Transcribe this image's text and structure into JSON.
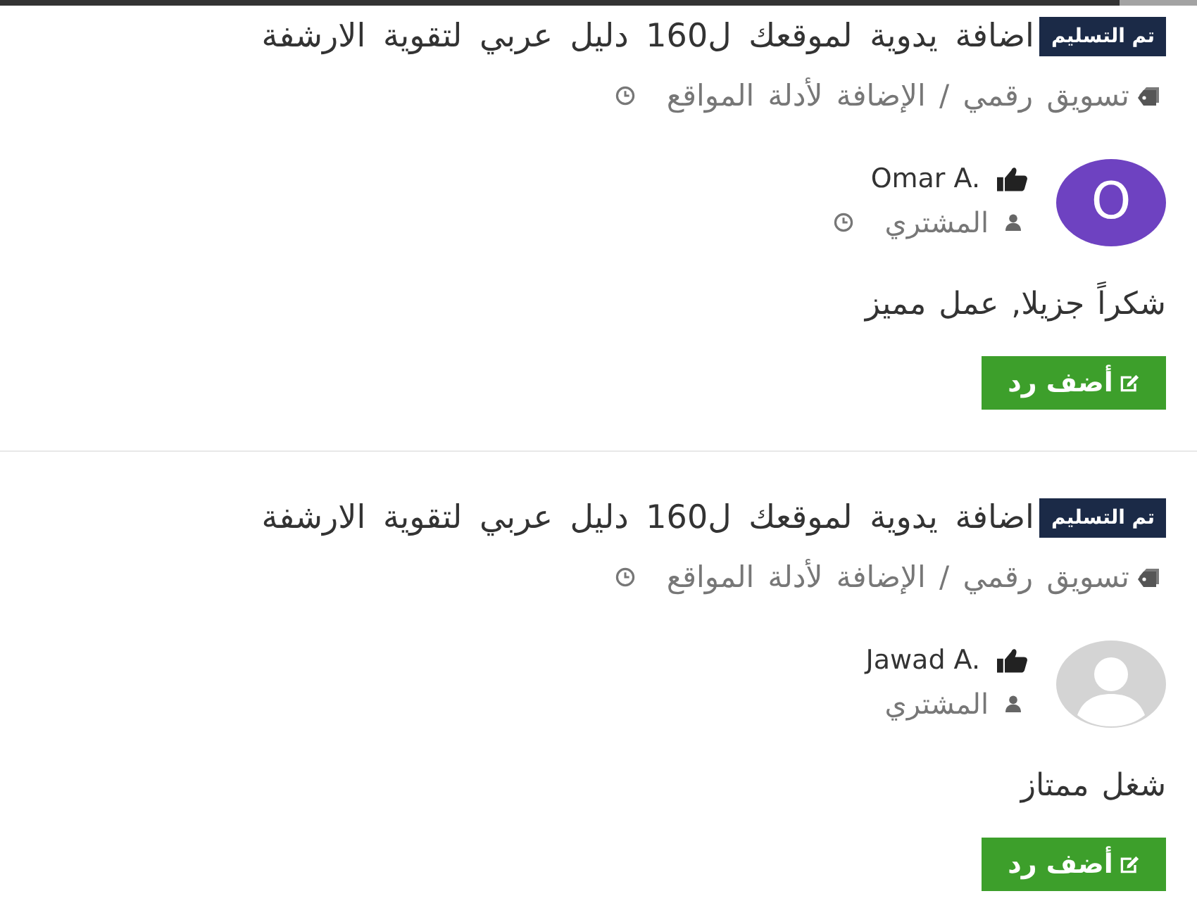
{
  "reviews": [
    {
      "status_badge": "تم التسليم",
      "title": "اضافة يدوية لموقعك ل160 دليل عربي لتقوية الارشفة",
      "category_path": "تسويق رقمي / الإضافة لأدلة المواقع",
      "reviewer": {
        "name": "Omar A.",
        "avatar": {
          "kind": "initial",
          "initial": "O",
          "color": "#6e42c1"
        },
        "role": "المشتري",
        "time_shown": true
      },
      "comment": "شكراً جزيلا, عمل مميز",
      "reply_button": "أضف رد"
    },
    {
      "status_badge": "تم التسليم",
      "title": "اضافة يدوية لموقعك ل160 دليل عربي لتقوية الارشفة",
      "category_path": "تسويق رقمي / الإضافة لأدلة المواقع",
      "reviewer": {
        "name": "Jawad A.",
        "avatar": {
          "kind": "default"
        },
        "role": "المشتري",
        "time_shown": false
      },
      "comment": "شغل ممتاز",
      "reply_button": "أضف رد"
    }
  ]
}
